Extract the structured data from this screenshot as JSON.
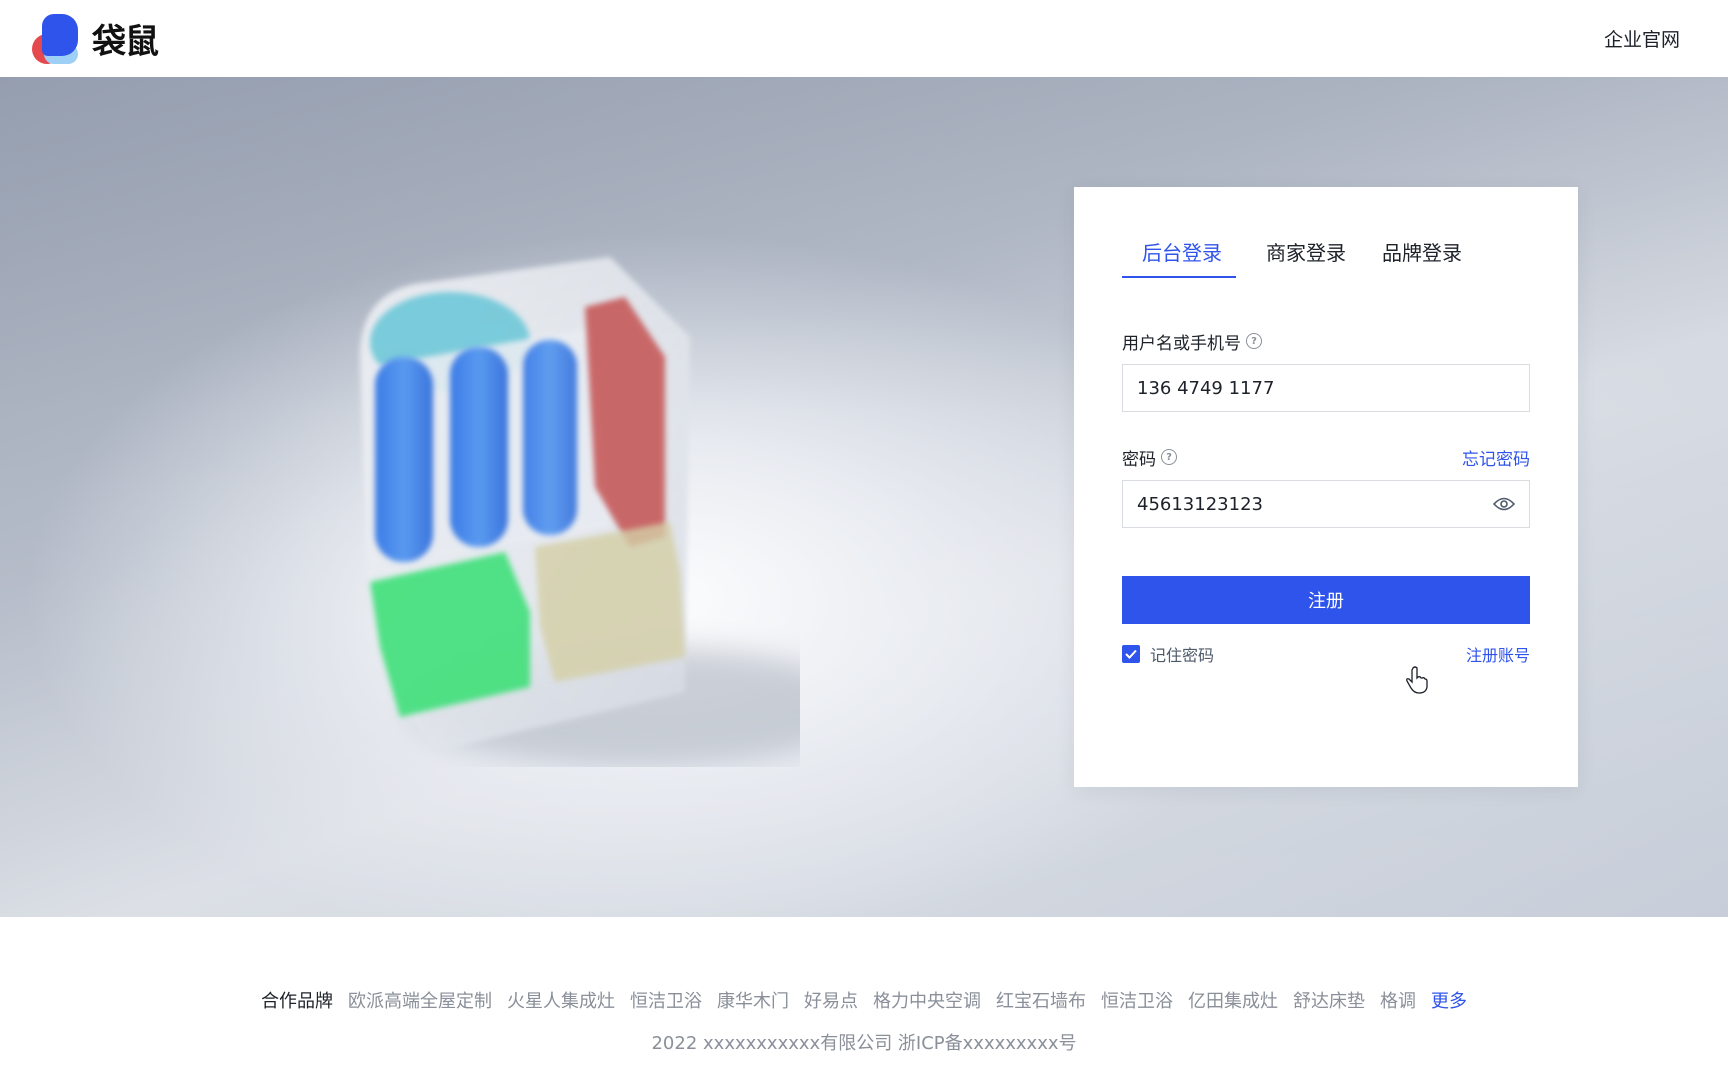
{
  "header": {
    "brand_name": "袋鼠",
    "official_site_link": "企业官网"
  },
  "login": {
    "tabs": [
      {
        "label": "后台登录",
        "active": true
      },
      {
        "label": "商家登录",
        "active": false
      },
      {
        "label": "品牌登录",
        "active": false
      }
    ],
    "username": {
      "label": "用户名或手机号",
      "value": "136 4749 1177"
    },
    "password": {
      "label": "密码",
      "value": "45613123123",
      "forgot_label": "忘记密码"
    },
    "submit_label": "注册",
    "remember_label": "记住密码",
    "remember_checked": true,
    "register_label": "注册账号"
  },
  "footer": {
    "partners_label": "合作品牌",
    "partners": [
      "欧派高端全屋定制",
      "火星人集成灶",
      "恒洁卫浴",
      "康华木门",
      "好易点",
      "格力中央空调",
      "红宝石墙布",
      "恒洁卫浴",
      "亿田集成灶",
      "舒达床垫",
      "格调"
    ],
    "more_label": "更多",
    "copyright": "2022 xxxxxxxxxxx有限公司 浙ICP备xxxxxxxxx号"
  },
  "colors": {
    "accent": "#2f54eb",
    "text": "#1d2129",
    "muted": "#8a8f99"
  }
}
